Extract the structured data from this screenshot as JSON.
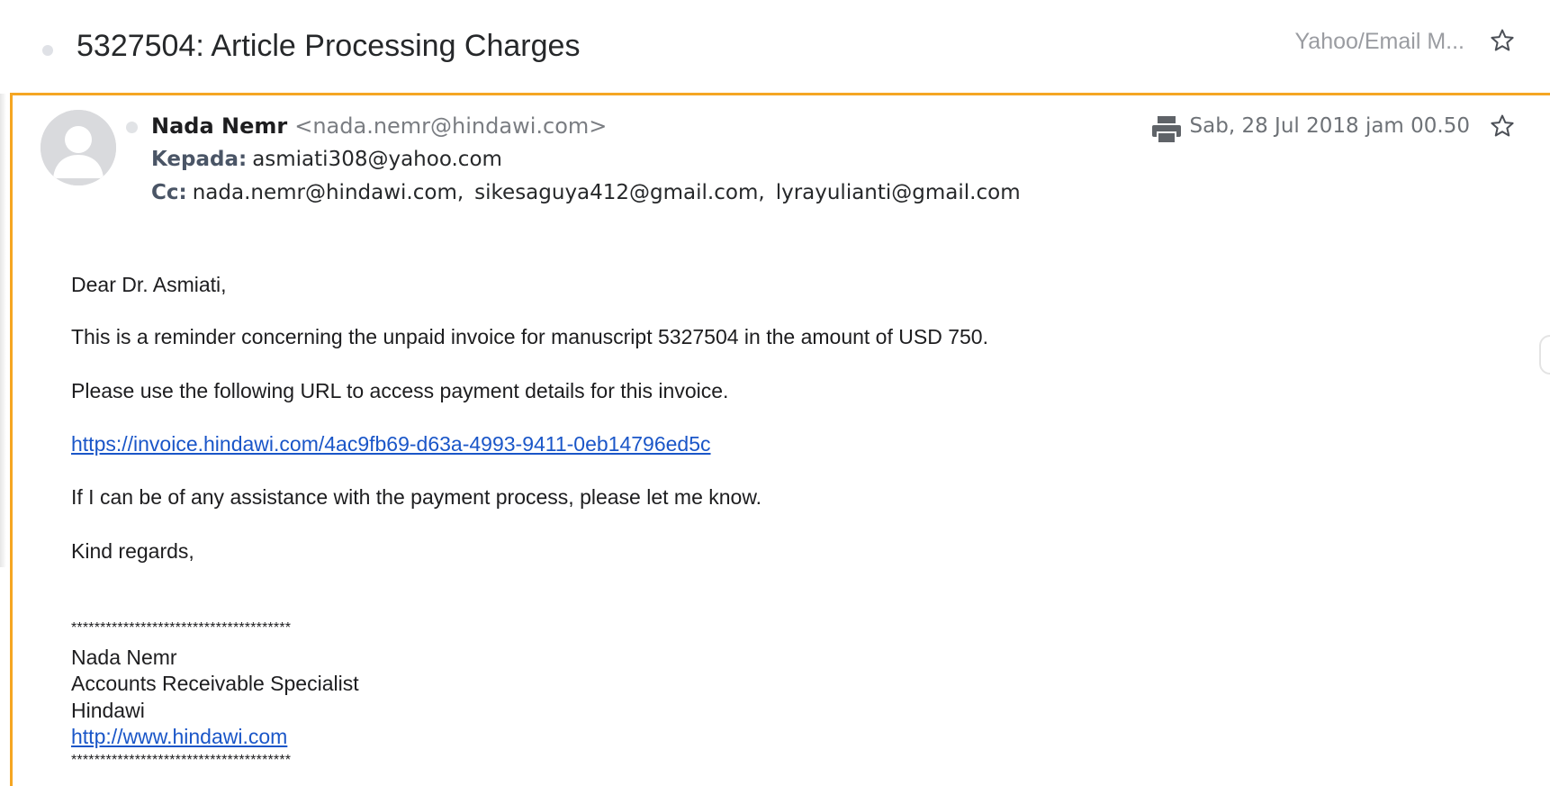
{
  "subject": {
    "title": "5327504: Article Processing Charges",
    "folder": "Yahoo/Email M..."
  },
  "message": {
    "sender_name": "Nada Nemr",
    "sender_email": "<nada.nemr@hindawi.com>",
    "to_label": "Kepada:",
    "to_value": "asmiati308@yahoo.com",
    "cc_label": "Cc:",
    "cc": [
      "nada.nemr@hindawi.com,",
      "sikesaguya412@gmail.com,",
      "lyrayulianti@gmail.com"
    ],
    "date": "Sab, 28 Jul 2018 jam 00.50"
  },
  "body": {
    "greeting": "Dear Dr. Asmiati,",
    "line1": "This is a reminder concerning the unpaid invoice for manuscript 5327504 in the amount of USD 750.",
    "line2": "Please use the following URL to access payment details for this invoice.",
    "invoice_link": "https://invoice.hindawi.com/4ac9fb69-d63a-4993-9411-0eb14796ed5c",
    "line3": "If I can be of any assistance with the payment process, please let me know.",
    "closing": "Kind regards,"
  },
  "signature": {
    "divider": "**************************************",
    "name": "Nada Nemr",
    "role": "Accounts Receivable Specialist",
    "company": "Hindawi",
    "website": "http://www.hindawi.com",
    "divider_bottom": "**************************************"
  },
  "icons": {
    "star": "star-outline-icon",
    "print": "printer-icon",
    "avatar": "default-avatar-icon"
  },
  "colors": {
    "accent_border": "#f5a623",
    "link": "#1a56c8"
  }
}
